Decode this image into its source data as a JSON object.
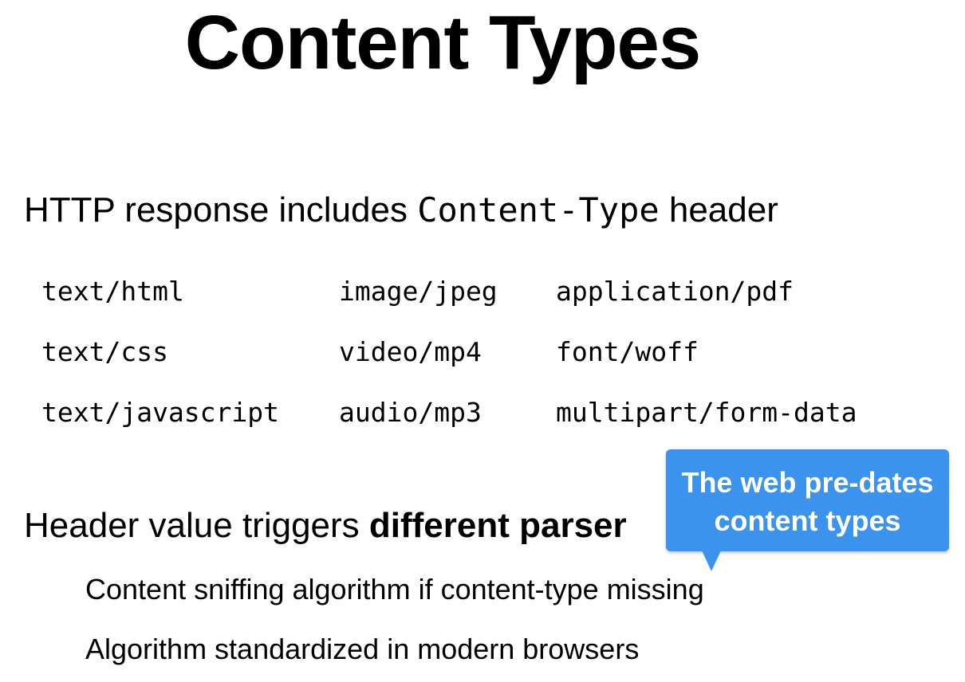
{
  "title": "Content Types",
  "bullet1": {
    "before": "HTTP response includes ",
    "code": "Content-Type",
    "after": " header"
  },
  "content_types": [
    [
      "text/html",
      "image/jpeg",
      "application/pdf"
    ],
    [
      "text/css",
      "video/mp4",
      "font/woff"
    ],
    [
      "text/javascript",
      "audio/mp3",
      "multipart/form-data"
    ]
  ],
  "bullet2": {
    "before": "Header value triggers ",
    "bold": "different parser"
  },
  "sub_bullets": [
    "Content sniffing algorithm if content-type missing",
    "Algorithm standardized in modern browsers"
  ],
  "callout": {
    "line1": "The web pre-dates",
    "line2": "content types",
    "color": "#3b93ee"
  }
}
